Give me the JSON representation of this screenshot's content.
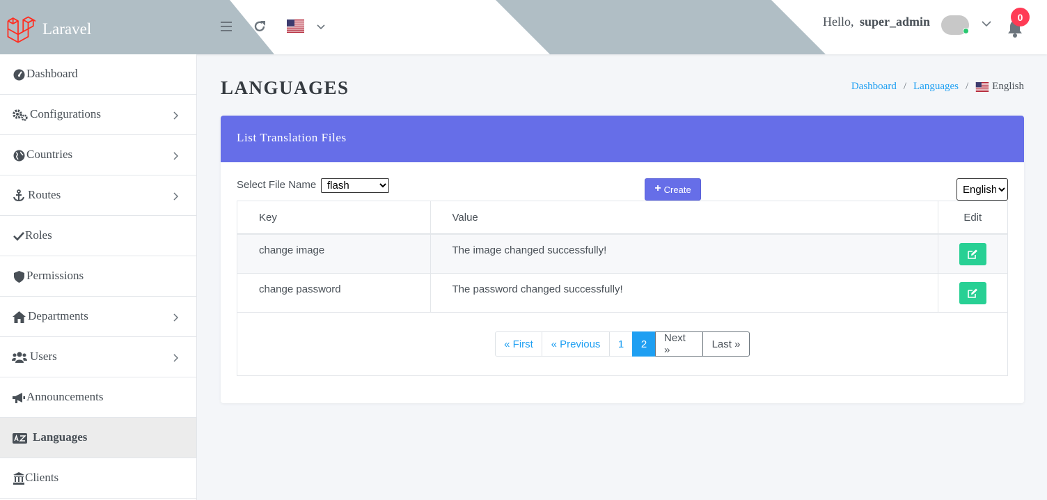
{
  "brand": {
    "name": "Laravel"
  },
  "header": {
    "greeting": "Hello,",
    "username": "super_admin",
    "notification_count": "0",
    "colors": {
      "banner": "#b0bec5",
      "badge": "#ff3b55"
    }
  },
  "sidebar": {
    "items": [
      {
        "label": "Dashboard",
        "icon": "dashboard-icon",
        "has_children": false
      },
      {
        "label": "Configurations",
        "icon": "cogs-icon",
        "has_children": true
      },
      {
        "label": "Countries",
        "icon": "globe-icon",
        "has_children": true
      },
      {
        "label": "Routes",
        "icon": "anchor-icon",
        "has_children": true
      },
      {
        "label": "Roles",
        "icon": "check-icon",
        "has_children": false
      },
      {
        "label": "Permissions",
        "icon": "shield-icon",
        "has_children": false
      },
      {
        "label": "Departments",
        "icon": "home-icon",
        "has_children": true
      },
      {
        "label": "Users",
        "icon": "users-icon",
        "has_children": true
      },
      {
        "label": "Announcements",
        "icon": "bullhorn-icon",
        "has_children": false
      },
      {
        "label": "Languages",
        "icon": "language-icon",
        "has_children": false,
        "active": true
      },
      {
        "label": "Clients",
        "icon": "building-icon",
        "has_children": false
      }
    ]
  },
  "page": {
    "title": "LANGUAGES",
    "breadcrumb": {
      "home": "Dashboard",
      "section": "Languages",
      "current": "English"
    }
  },
  "card": {
    "title": "List Translation Files",
    "file_label": "Select File Name",
    "file_selected": "flash",
    "create_label": "Create",
    "language_selected": "English",
    "accent": "#666ee8",
    "table": {
      "headers": [
        "Key",
        "Value",
        "Edit"
      ],
      "rows": [
        {
          "key": "change image",
          "value": "The image changed successfully!"
        },
        {
          "key": "change password",
          "value": "The password changed successfully!"
        }
      ]
    },
    "pagination": {
      "first": "« First",
      "previous": "« Previous",
      "pages": [
        "1",
        "2"
      ],
      "current": "2",
      "next": "Next »",
      "last": "Last »"
    }
  }
}
